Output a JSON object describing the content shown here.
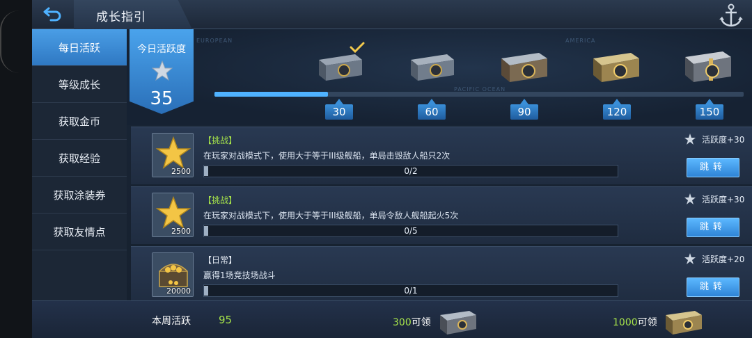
{
  "header": {
    "title": "成长指引",
    "back_icon": "back-arrow-icon",
    "anchor_icon": "anchor-icon"
  },
  "sidebar": {
    "items": [
      {
        "label": "每日活跃",
        "active": true
      },
      {
        "label": "等级成长",
        "active": false
      },
      {
        "label": "获取金币",
        "active": false
      },
      {
        "label": "获取经验",
        "active": false
      },
      {
        "label": "获取涂装券",
        "active": false
      },
      {
        "label": "获取友情点",
        "active": false
      }
    ]
  },
  "progress": {
    "today_label": "今日活跃度",
    "today_value": "35",
    "track_fraction": 0.215,
    "milestones": [
      {
        "value": "30",
        "claimed": true
      },
      {
        "value": "60",
        "claimed": false
      },
      {
        "value": "90",
        "claimed": false
      },
      {
        "value": "120",
        "claimed": false
      },
      {
        "value": "150",
        "claimed": false
      }
    ],
    "map_labels": [
      "EUROPEAN",
      "PACIFIC OCEAN",
      "AMERICA"
    ]
  },
  "tasks": [
    {
      "tag": "【挑战】",
      "type": "challenge",
      "desc": "在玩家对战模式下，使用大于等于III级舰船，单局击毁敌人船只2次",
      "progress": "0/2",
      "icon_count": "2500",
      "reward": "活跃度+30",
      "button": "跳转"
    },
    {
      "tag": "【挑战】",
      "type": "challenge",
      "desc": "在玩家对战模式下，使用大于等于III级舰船，单局令敌人舰船起火5次",
      "progress": "0/5",
      "icon_count": "2500",
      "reward": "活跃度+30",
      "button": "跳转"
    },
    {
      "tag": "【日常】",
      "type": "daily",
      "desc": "赢得1场竞技场战斗",
      "progress": "0/1",
      "icon_count": "20000",
      "reward": "活跃度+20",
      "button": "跳转"
    }
  ],
  "weekly": {
    "label": "本周活跃",
    "value": "95",
    "claims": [
      {
        "num": "300",
        "suffix": "可领"
      },
      {
        "num": "1000",
        "suffix": "可领"
      }
    ]
  },
  "colors": {
    "accent": "#4fb2ff",
    "highlight_green": "#a6e34a",
    "active_tab": "#3a8ad6"
  }
}
